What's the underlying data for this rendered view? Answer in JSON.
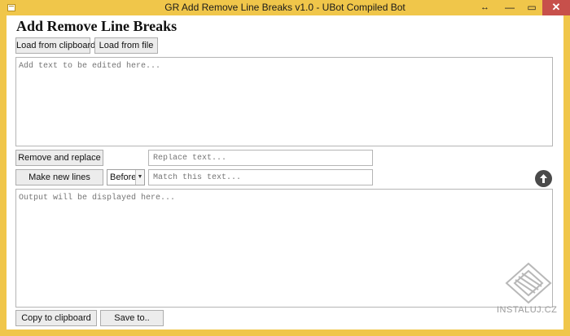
{
  "window": {
    "title": "GR Add Remove Line Breaks v1.0 - UBot Compiled Bot",
    "resize_icon": "↔",
    "minimize_label": "—",
    "maximize_label": "▭",
    "close_label": "✕"
  },
  "app": {
    "heading": "Add Remove Line Breaks"
  },
  "toolbar": {
    "load_clipboard_label": "Load from clipboard",
    "load_file_label": "Load from file"
  },
  "input": {
    "placeholder": "Add text to be edited here...",
    "value": ""
  },
  "remove": {
    "button_label": "Remove and replace",
    "replace_placeholder": "Replace text..."
  },
  "newlines": {
    "button_label": "Make new lines",
    "position_selected": "Before",
    "match_placeholder": "Match this text..."
  },
  "output": {
    "placeholder": "Output will be displayed here...",
    "value": ""
  },
  "bottom": {
    "copy_label": "Copy to clipboard",
    "save_label": "Save to.."
  },
  "watermark": {
    "text": "INSTALUJ.CZ"
  },
  "colors": {
    "titlebar": "#f0c64a",
    "close_button": "#c7504b",
    "accent_icon": "#4a4a4a"
  },
  "icons": {
    "app": "app-window-icon",
    "scroll_up": "arrow-up-circle-icon"
  }
}
